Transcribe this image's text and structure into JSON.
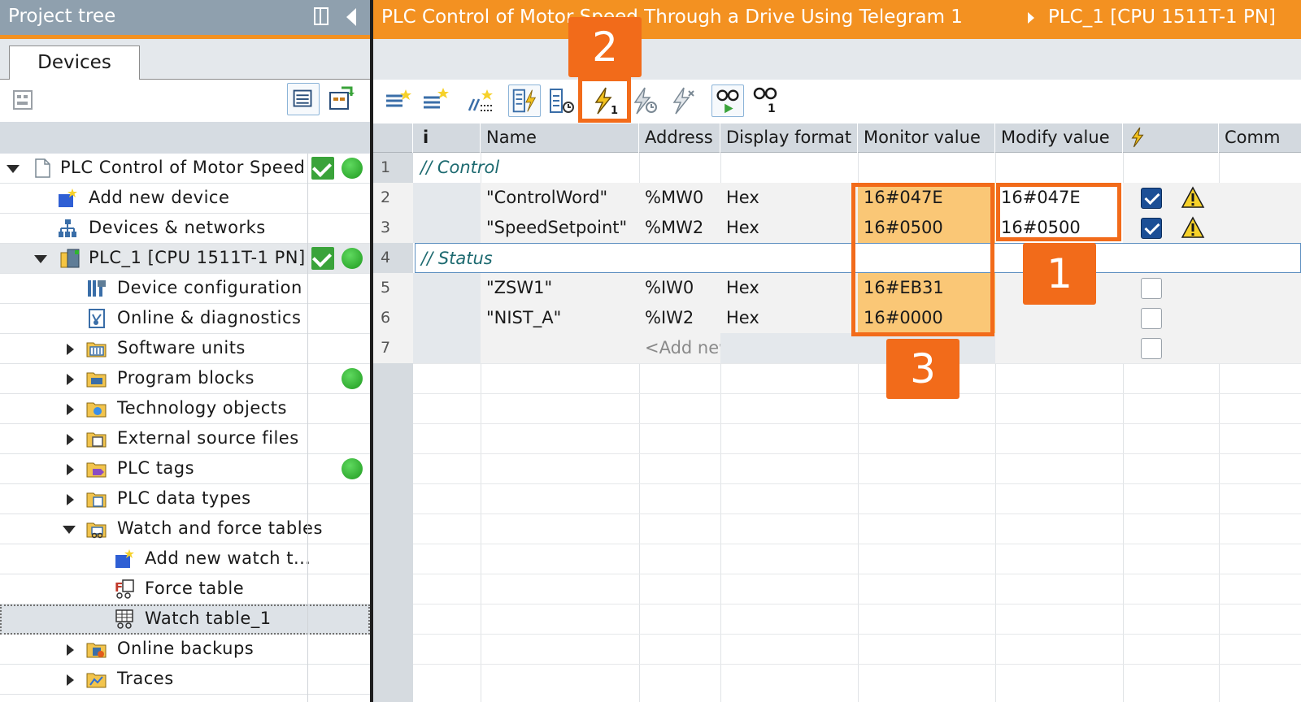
{
  "project_tree": {
    "title": "Project tree",
    "tab": "Devices",
    "items": [
      {
        "label": "PLC Control of Motor Speed ...",
        "status_ok": true,
        "online": true
      },
      {
        "label": "Add new device"
      },
      {
        "label": "Devices & networks"
      },
      {
        "label": "PLC_1 [CPU 1511T-1 PN]",
        "status_ok": true,
        "online": true
      },
      {
        "label": "Device configuration"
      },
      {
        "label": "Online & diagnostics"
      },
      {
        "label": "Software units"
      },
      {
        "label": "Program blocks",
        "online": true
      },
      {
        "label": "Technology objects"
      },
      {
        "label": "External source files"
      },
      {
        "label": "PLC tags",
        "online": true
      },
      {
        "label": "PLC data types"
      },
      {
        "label": "Watch and force tables"
      },
      {
        "label": "Add new watch t..."
      },
      {
        "label": "Force table"
      },
      {
        "label": "Watch table_1"
      },
      {
        "label": "Online backups"
      },
      {
        "label": "Traces"
      }
    ]
  },
  "breadcrumb": {
    "part1": "PLC Control of Motor Speed Through a Drive Using Telegram 1",
    "part2": "PLC_1 [CPU 1511T-1 PN]"
  },
  "toolbar": {
    "icons": [
      "insert-row-icon",
      "add-row-icon",
      "preview-icon",
      "monitor-all-icon",
      "monitor-now-icon",
      "modify-now-icon",
      "modify-trigger-icon",
      "force-icon",
      "enable-peripheral-icon",
      "show-monitor-icon",
      "monitor-once-icon"
    ]
  },
  "watch_table": {
    "columns": [
      "i",
      "Name",
      "Address",
      "Display format",
      "Monitor value",
      "Modify value",
      "",
      "Comm"
    ],
    "rows": [
      {
        "num": "1",
        "comment": "// Control"
      },
      {
        "num": "2",
        "name": "\"ControlWord\"",
        "address": "%MW0",
        "format": "Hex",
        "monitor": "16#047E",
        "modify": "16#047E",
        "checked": true,
        "warning": true
      },
      {
        "num": "3",
        "name": "\"SpeedSetpoint\"",
        "address": "%MW2",
        "format": "Hex",
        "monitor": "16#0500",
        "modify": "16#0500",
        "checked": true,
        "warning": true
      },
      {
        "num": "4",
        "comment": "// Status"
      },
      {
        "num": "5",
        "name": "\"ZSW1\"",
        "address": "%IW0",
        "format": "Hex",
        "monitor": "16#EB31",
        "modify": "",
        "checked": false
      },
      {
        "num": "6",
        "name": "\"NIST_A\"",
        "address": "%IW2",
        "format": "Hex",
        "monitor": "16#0000",
        "modify": "",
        "checked": false
      },
      {
        "num": "7",
        "address": "<Add new>",
        "checked": false
      }
    ]
  },
  "callouts": [
    "1",
    "2",
    "3"
  ],
  "colors": {
    "accent": "#f39121",
    "callout": "#f26b1a",
    "monitor_highlight": "#fac776",
    "online_green": "#2fb52f"
  }
}
